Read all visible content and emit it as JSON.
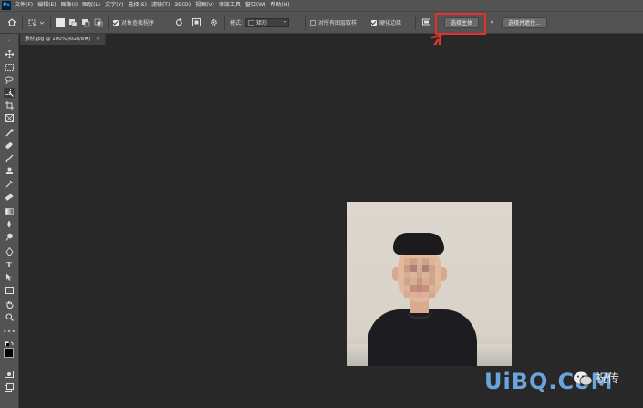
{
  "app": {
    "logo": "Ps",
    "menu": [
      "文件(F)",
      "编辑(E)",
      "图像(I)",
      "图层(L)",
      "文字(Y)",
      "选择(S)",
      "滤镜(T)",
      "3D(D)",
      "视图(V)",
      "增效工具",
      "窗口(W)",
      "帮助(H)"
    ]
  },
  "options": {
    "sample_all_layers_label": "对象查找程序",
    "mode_label": "模式:",
    "mode_value": "矩形",
    "all_layers_label": "对所有图层取样",
    "hard_edge_label": "硬化边缘",
    "select_subject_label": "选择主体",
    "select_and_mask_label": "选择并遮住..."
  },
  "document": {
    "tab_title": "素材.jpg @ 100%(RGB/8#)",
    "close_glyph": "×"
  },
  "watermark": {
    "brand": "UiBQ.CoM",
    "text": "祝传"
  },
  "colors": {
    "highlight": "#e0312b",
    "ui_bg": "#535353",
    "canvas_bg": "#282828",
    "watermark_blue": "#6ba4dd"
  }
}
